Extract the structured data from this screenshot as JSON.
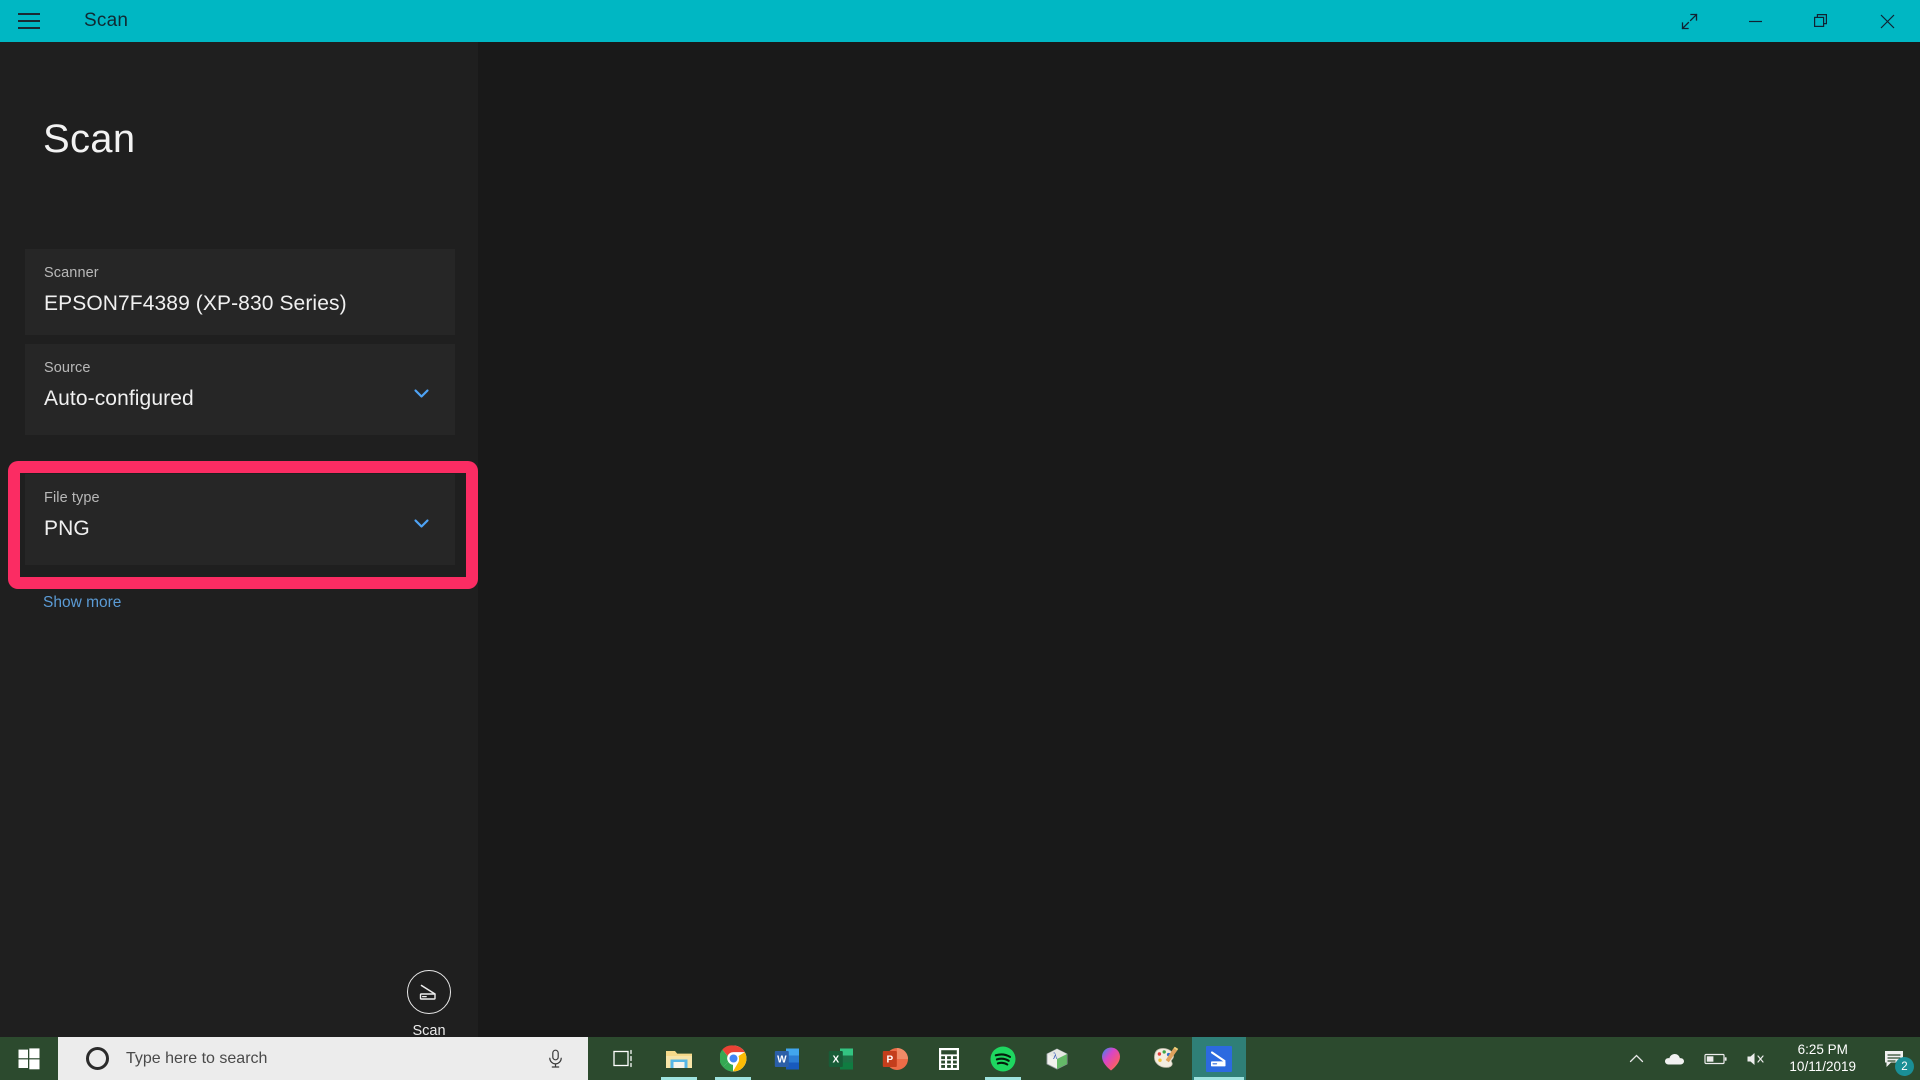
{
  "window": {
    "title": "Scan",
    "accent_color": "#00b7c3",
    "menu_icon": "hamburger-menu-icon",
    "controls": [
      {
        "name": "fullscreen-button",
        "icon": "diagonal-arrows-icon",
        "label": "Full screen"
      },
      {
        "name": "minimize-button",
        "icon": "minimize-icon",
        "label": "Minimize"
      },
      {
        "name": "maximize-button",
        "icon": "restore-icon",
        "label": "Restore"
      },
      {
        "name": "close-button",
        "icon": "close-icon",
        "label": "Close"
      }
    ]
  },
  "sidebar": {
    "heading": "Scan",
    "fields": [
      {
        "name": "scanner",
        "label": "Scanner",
        "value": "EPSON7F4389 (XP-830 Series)",
        "has_dropdown": false
      },
      {
        "name": "source",
        "label": "Source",
        "value": "Auto-configured",
        "has_dropdown": true
      },
      {
        "name": "file-type",
        "label": "File type",
        "value": "PNG",
        "has_dropdown": true,
        "highlighted": true
      }
    ],
    "show_more_label": "Show more",
    "scan_button": {
      "label": "Scan",
      "icon": "scanner-icon"
    }
  },
  "highlight": {
    "color": "#fb2c63",
    "target": "file-type-dropdown"
  },
  "taskbar": {
    "background_color": "#2c4a2e",
    "start_label": "Start",
    "search": {
      "placeholder": "Type here to search",
      "cortana_icon": "cortana-circle-icon",
      "mic_icon": "microphone-icon"
    },
    "apps": [
      {
        "name": "task-view",
        "icon": "task-view-icon",
        "running": false,
        "active": false
      },
      {
        "name": "file-explorer",
        "icon": "folder-icon",
        "running": true,
        "active": false
      },
      {
        "name": "google-chrome",
        "icon": "chrome-icon",
        "running": true,
        "active": false
      },
      {
        "name": "microsoft-word",
        "icon": "word-icon",
        "running": false,
        "active": false
      },
      {
        "name": "microsoft-excel",
        "icon": "excel-icon",
        "running": false,
        "active": false
      },
      {
        "name": "microsoft-powerpoint",
        "icon": "powerpoint-icon",
        "running": false,
        "active": false
      },
      {
        "name": "calculator",
        "icon": "calculator-icon",
        "running": false,
        "active": false
      },
      {
        "name": "spotify",
        "icon": "spotify-icon",
        "running": true,
        "active": false
      },
      {
        "name": "lambda-app",
        "icon": "lambda-cube-icon",
        "running": false,
        "active": false
      },
      {
        "name": "paint-3d",
        "icon": "paint-3d-icon",
        "running": false,
        "active": false
      },
      {
        "name": "paint",
        "icon": "paint-palette-icon",
        "running": false,
        "active": false
      },
      {
        "name": "windows-scan",
        "icon": "scanner-app-icon",
        "running": true,
        "active": true
      }
    ],
    "tray": [
      {
        "name": "show-hidden-icons",
        "icon": "chevron-up-icon"
      },
      {
        "name": "onedrive",
        "icon": "cloud-icon"
      },
      {
        "name": "battery",
        "icon": "battery-icon"
      },
      {
        "name": "volume",
        "icon": "speaker-muted-icon"
      }
    ],
    "clock": {
      "time": "6:25 PM",
      "date": "10/11/2019"
    },
    "notifications": {
      "icon": "action-center-icon",
      "count": "2"
    }
  }
}
